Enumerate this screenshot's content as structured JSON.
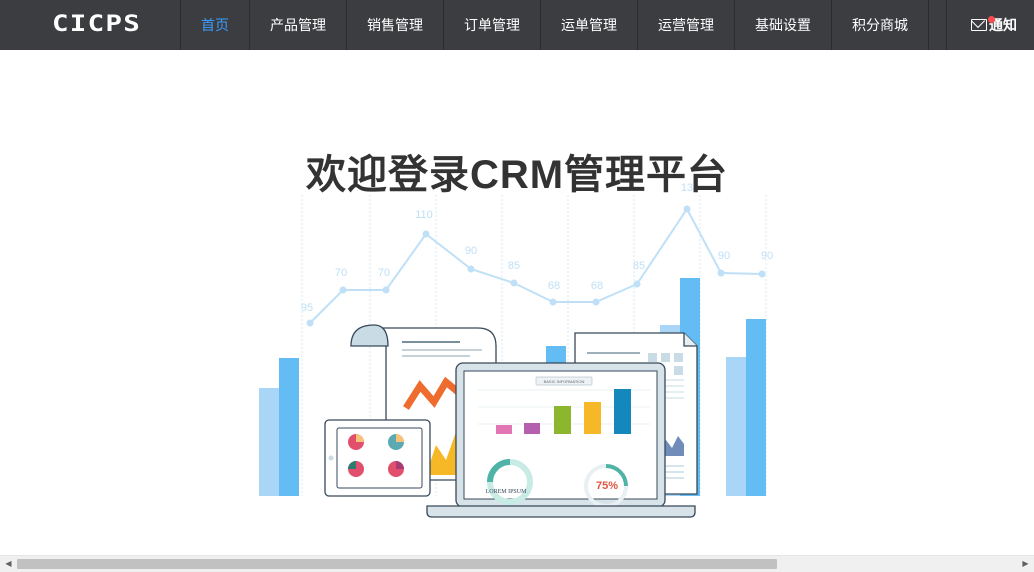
{
  "header": {
    "logo_text": "CICPS",
    "nav": [
      {
        "label": "首页",
        "active": true
      },
      {
        "label": "产品管理",
        "active": false
      },
      {
        "label": "销售管理",
        "active": false
      },
      {
        "label": "订单管理",
        "active": false
      },
      {
        "label": "运单管理",
        "active": false
      },
      {
        "label": "运营管理",
        "active": false
      },
      {
        "label": "基础设置",
        "active": false
      },
      {
        "label": "积分商城",
        "active": false
      }
    ],
    "notify_label": "通知",
    "notify_icon": "mail-icon"
  },
  "main": {
    "welcome_title": "欢迎登录CRM管理平台",
    "illustration": {
      "line_values": [
        "95",
        "70",
        "70",
        "110",
        "90",
        "85",
        "68",
        "68",
        "85",
        "130",
        "90",
        "90"
      ],
      "laptop_title": "BASIC INFORMATION",
      "laptop_caption": "LOREM IPSUM",
      "laptop_percent": "75%"
    }
  },
  "colors": {
    "header_bg": "#3b3d40",
    "nav_active": "#3b9cff",
    "notify_dot": "#ff4d4f",
    "bar_dark": "#64bcf5",
    "bar_light": "#a9d6f7"
  }
}
